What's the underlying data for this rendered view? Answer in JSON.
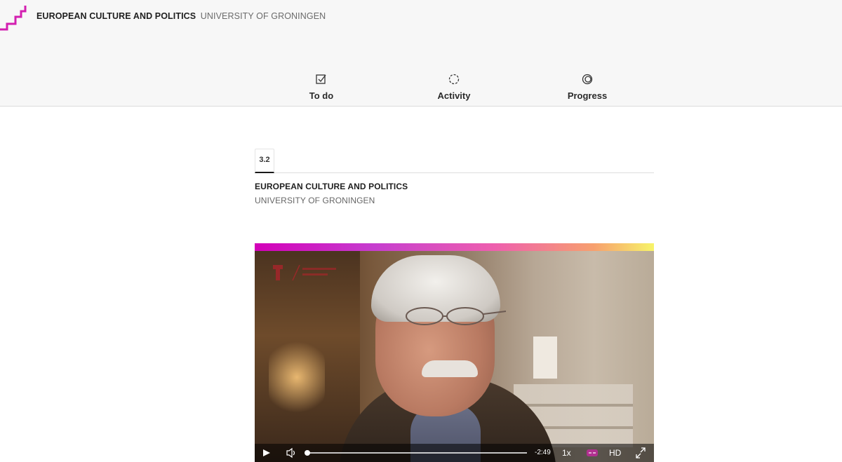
{
  "header": {
    "course_title": "EUROPEAN CULTURE AND POLITICS",
    "university": "UNIVERSITY OF GRONINGEN",
    "logo_icon": "stair-step-logo-icon",
    "accent_color": "#d31fb0"
  },
  "nav": {
    "items": [
      {
        "label": "To do",
        "icon": "checkbox-edit-icon"
      },
      {
        "label": "Activity",
        "icon": "activity-ring-icon"
      },
      {
        "label": "Progress",
        "icon": "progress-ring-icon"
      }
    ]
  },
  "step": {
    "tab_label": "3.2",
    "course_title": "EUROPEAN CULTURE AND POLITICS",
    "university": "UNIVERSITY OF GRONINGEN"
  },
  "video": {
    "gradient_colors": [
      "#d300b8",
      "#c63ecf",
      "#ee5fae",
      "#f7a06e",
      "#f7f46a"
    ],
    "controls": {
      "play_icon": "play-icon",
      "volume_icon": "volume-icon",
      "time_remaining": "-2:49",
      "speed": "1x",
      "captions_icon": "captions-icon",
      "quality": "HD",
      "fullscreen_icon": "fullscreen-icon",
      "progress_fraction": 0.01
    }
  }
}
